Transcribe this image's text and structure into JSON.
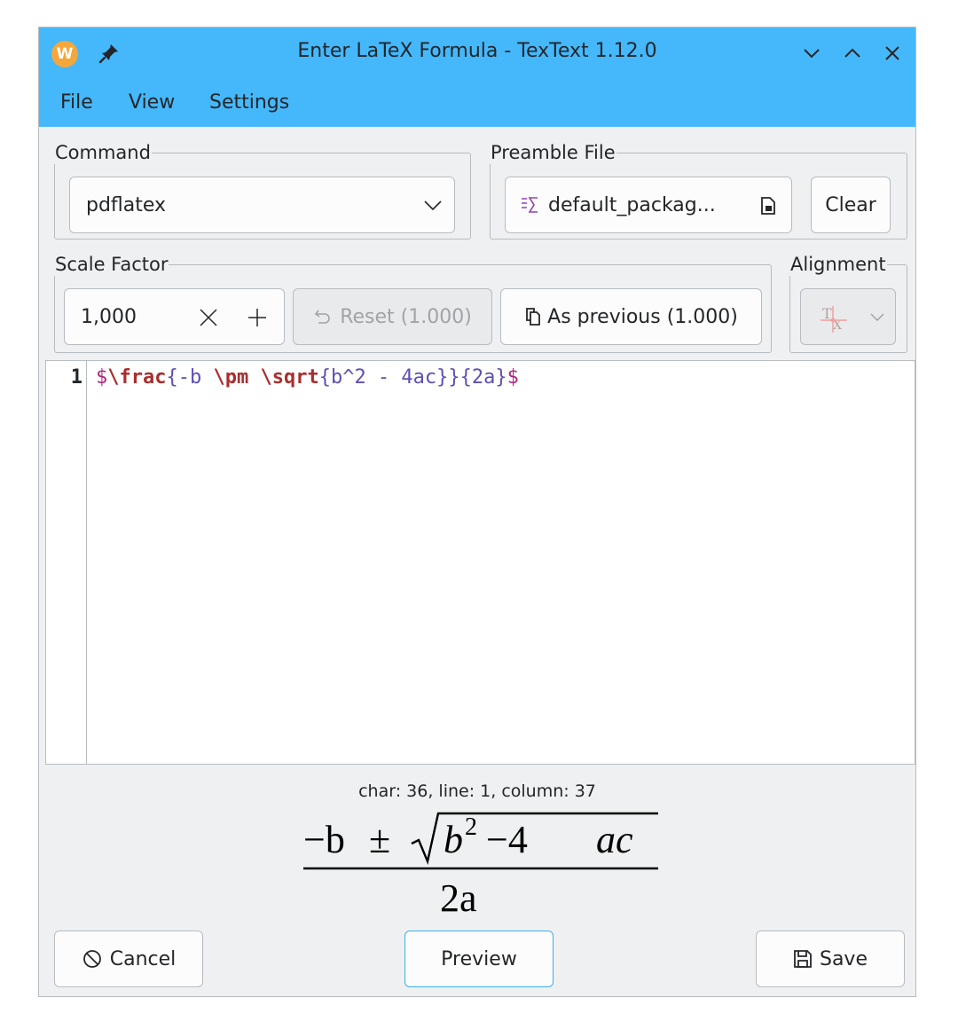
{
  "window": {
    "title": "Enter LaTeX Formula - TexText 1.12.0",
    "app_icon_glyph": "W",
    "accent_color": "#45b8fc",
    "controls": [
      "minimize-icon",
      "maximize-icon",
      "close-icon"
    ]
  },
  "menu": {
    "file": "File",
    "view": "View",
    "settings": "Settings"
  },
  "command": {
    "label": "Command",
    "value": "pdflatex"
  },
  "preamble": {
    "label": "Preamble File",
    "file": "default_packag...",
    "clear": "Clear"
  },
  "scale": {
    "label": "Scale Factor",
    "value": "1,000",
    "reset": "Reset (1.000)",
    "as_previous": "As previous (1.000)"
  },
  "alignment": {
    "label": "Alignment"
  },
  "editor": {
    "line_number": "1",
    "tokens": {
      "dollar_open": "$",
      "cmd_frac": "\\frac",
      "arg1_open": "{-b ",
      "cmd_pm": "\\pm",
      "space": " ",
      "cmd_sqrt": "\\sqrt",
      "arg2": "{b^2 - 4ac}}{2a}",
      "dollar_close": "$"
    }
  },
  "status": "char: 36, line: 1, column: 37",
  "preview_formula": {
    "numerator": [
      "−b",
      "±",
      "b",
      "2",
      "−4",
      "ac"
    ],
    "denominator": "2a"
  },
  "buttons": {
    "cancel": "Cancel",
    "preview": "Preview",
    "save": "Save"
  }
}
